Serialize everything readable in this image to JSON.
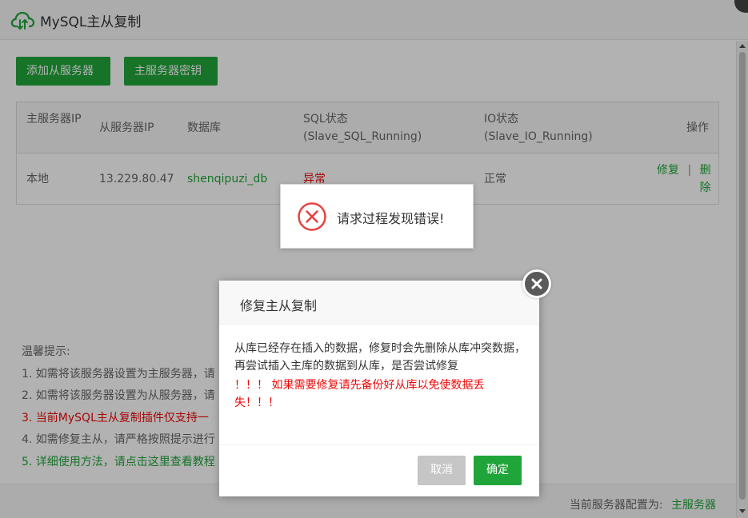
{
  "window": {
    "title": "MySQL主从复制"
  },
  "toolbar": {
    "add_slave_label": "添加从服务器",
    "master_key_label": "主服务器密钥"
  },
  "table": {
    "headers": {
      "master_ip": "主服务器IP",
      "slave_ip": "从服务器IP",
      "database": "数据库",
      "sql_status_line1": "SQL状态",
      "sql_status_line2": "(Slave_SQL_Running)",
      "io_status_line1": "IO状态",
      "io_status_line2": "(Slave_IO_Running)",
      "actions": "操作"
    },
    "rows": [
      {
        "master_ip": "本地",
        "slave_ip": "13.229.80.47",
        "database": "shenqipuzi_db",
        "sql_status": "异常",
        "io_status": "正常",
        "action_repair": "修复",
        "action_sep": "|",
        "action_delete": "删除"
      }
    ]
  },
  "tips": {
    "title": "温馨提示:",
    "items": [
      "1. 如需将该服务器设置为主服务器，请",
      "2. 如需将该服务器设置为从服务器，请",
      "3. 当前MySQL主从复制插件仅支持一",
      "4. 如需修复主从，请严格按照提示进行",
      "5. 详细使用方法，请点击这里查看教程"
    ]
  },
  "footer": {
    "config_label": "当前服务器配置为:",
    "config_value": "主服务器"
  },
  "toast": {
    "message": "请求过程发现错误!"
  },
  "dialog": {
    "title": "修复主从复制",
    "body": "从库已经存在插入的数据，修复时会先删除从库冲突数据，再尝试插入主库的数据到从库，是否尝试修复",
    "warning": "！！！ 如果需要修复请先备份好从库以免使数据丢失！！！",
    "cancel_label": "取消",
    "ok_label": "确定"
  },
  "colors": {
    "accent_green": "#20a53a",
    "error_red": "#ef0808"
  }
}
